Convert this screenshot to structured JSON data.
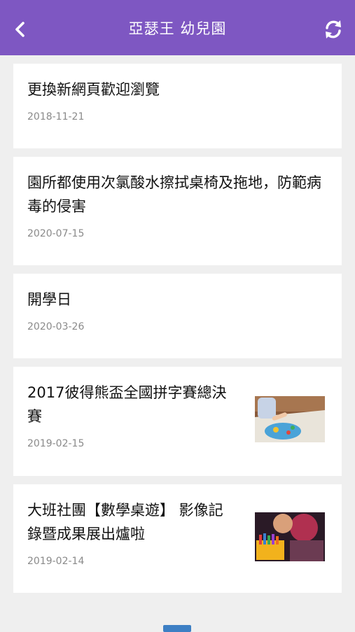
{
  "header": {
    "title": "亞瑟王 幼兒園",
    "back_icon": "back-chevron-icon",
    "refresh_icon": "refresh-icon",
    "bg_color": "#7e57c2"
  },
  "news": [
    {
      "title": "更換新網頁歡迎瀏覽",
      "date": "2018-11-21"
    },
    {
      "title": "園所都使用次氯酸水擦拭桌椅及拖地，防範病毒的侵害",
      "date": "2020-07-15"
    },
    {
      "title": "開學日",
      "date": "2020-03-26"
    },
    {
      "title": "2017彼得熊盃全國拼字賽總決賽",
      "date": "2019-02-15"
    },
    {
      "title": "大班社團【數學桌遊】 影像記錄暨成果展出爐啦",
      "date": "2019-02-14"
    }
  ]
}
